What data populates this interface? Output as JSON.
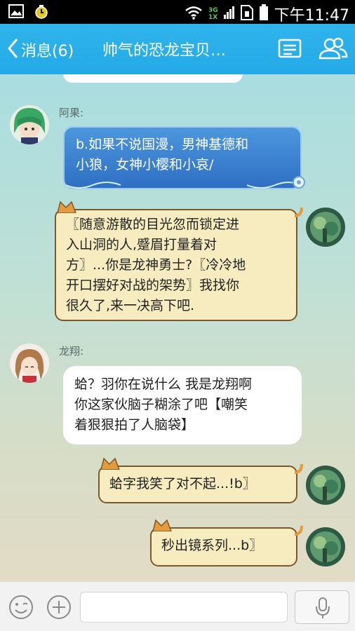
{
  "statusbar": {
    "time": "下午11:47",
    "network": "3G",
    "network2": "1X",
    "icons": [
      "gallery-icon",
      "alarm-icon",
      "wifi-icon",
      "signal-icon",
      "sim-icon",
      "battery-icon"
    ]
  },
  "header": {
    "back_label": "消息(6)",
    "title": "帅气的恐龙宝贝…",
    "icons": [
      "profile-card-icon",
      "group-members-icon"
    ],
    "color": "#23a9e6"
  },
  "messages": [
    {
      "sender": "阿果:",
      "lines": [
        "b.如果不说国漫，男神基德和",
        "小狼，女神小樱和小哀/"
      ]
    },
    {
      "sender": "",
      "outgoing": true,
      "lines": [
        "〖随意游散的目光忽而锁定进",
        "入山洞的人,蹙眉打量着对",
        "方〗...你是龙神勇士?〖冷冷地",
        "开口摆好对战的架势〗我找你",
        "很久了,来一决高下吧."
      ]
    },
    {
      "sender": "龙翔:",
      "lines": [
        "蛤？羽你在说什么 我是龙翔啊",
        "你这家伙脑子糊涂了吧【嘲笑",
        "着狠狠拍了人脑袋】"
      ]
    },
    {
      "sender": "",
      "outgoing": true,
      "lines": [
        "蛤字我笑了对不起...!b〗"
      ]
    },
    {
      "sender": "",
      "outgoing": true,
      "lines": [
        "秒出镜系列...b〗"
      ]
    }
  ],
  "inputbar": {
    "icons": [
      "emoji-icon",
      "plus-icon",
      "microphone-icon"
    ]
  }
}
